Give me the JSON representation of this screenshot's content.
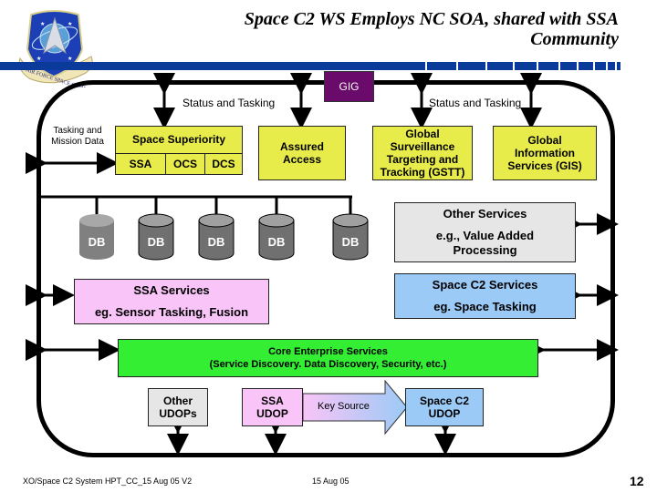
{
  "slide": {
    "title": "Space C2 WS Employs NC SOA, shared with SSA Community",
    "title_line1": "Space C2 WS Employs NC SOA, shared with SSA",
    "title_line2": "Community",
    "logo": "air-force-space-command-shield",
    "logo_text": "AIR FORCE SPACE COMMAND"
  },
  "network": {
    "gig_label": "GIG",
    "status_tasking_left": "Status and Tasking",
    "status_tasking_right": "Status and Tasking",
    "tasking_mission_data": [
      "Tasking and",
      "Mission Data"
    ]
  },
  "mission_areas": {
    "space_superiority": {
      "title": "Space Superiority",
      "subitems": [
        "SSA",
        "OCS",
        "DCS"
      ]
    },
    "assured_access": [
      "Assured",
      "Access"
    ],
    "gstt": [
      "Global",
      "Surveillance",
      "Targeting and",
      "Tracking (GSTT)"
    ],
    "gis": [
      "Global",
      "Information",
      "Services (GIS)"
    ]
  },
  "databases": [
    "DB",
    "DB",
    "DB",
    "DB",
    "DB"
  ],
  "services": {
    "other": {
      "title": "Other Services",
      "line2": "e.g., Value Added",
      "line3": "Processing"
    },
    "space_c2": {
      "title": "Space C2 Services",
      "subtitle": "eg. Space Tasking"
    },
    "ssa": {
      "title": "SSA Services",
      "subtitle": "eg. Sensor Tasking, Fusion"
    },
    "core": {
      "title": "Core Enterprise Services",
      "subtitle": "(Service Discovery. Data Discovery, Security, etc.)"
    }
  },
  "udops": {
    "other": [
      "Other",
      "UDOPs"
    ],
    "ssa": [
      "SSA",
      "UDOP"
    ],
    "key_source": "Key Source",
    "space_c2": [
      "Space C2",
      "UDOP"
    ]
  },
  "footer": {
    "doc_id": "XO/Space C2 System HPT_CC_15 Aug 05 V2",
    "date": "15 Aug 05",
    "page": "12"
  },
  "colors": {
    "title_bar": "#0a3a9a",
    "mission_yellow": "#e8ec4a",
    "gig_purple": "#6a0a6a",
    "other_gray": "#e6e6e6",
    "space_c2_blue": "#9ccaf6",
    "ssa_pink": "#f9c4f7",
    "core_green": "#33ee33"
  }
}
